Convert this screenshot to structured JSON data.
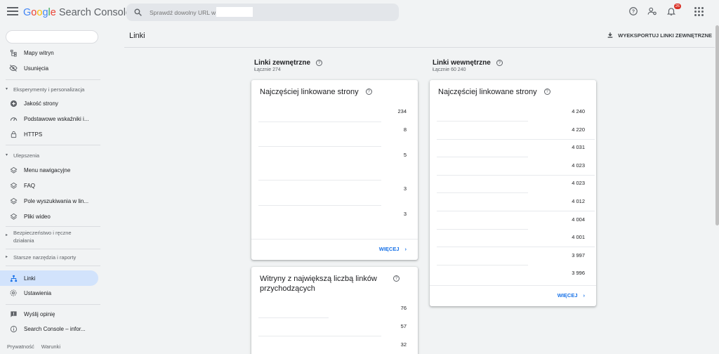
{
  "header": {
    "logo_google": [
      "G",
      "o",
      "o",
      "g",
      "l",
      "e"
    ],
    "logo_product": "Search Console",
    "search_placeholder": "Sprawdź dowolny URL w",
    "notification_count": "26"
  },
  "sidebar": {
    "items": [
      {
        "label": "Mapy witryn",
        "icon": "sitemap-icon"
      },
      {
        "label": "Usunięcia",
        "icon": "eye-off-icon"
      },
      {
        "label": "Jakość strony",
        "icon": "plus-circle-icon"
      },
      {
        "label": "Podstawowe wskaźniki i...",
        "icon": "gauge-icon"
      },
      {
        "label": "HTTPS",
        "icon": "lock-icon"
      },
      {
        "label": "Menu nawigacyjne",
        "icon": "layers-icon"
      },
      {
        "label": "FAQ",
        "icon": "layers-icon"
      },
      {
        "label": "Pole wyszukiwania w lin...",
        "icon": "layers-icon"
      },
      {
        "label": "Pliki wideo",
        "icon": "layers-icon"
      },
      {
        "label": "Linki",
        "icon": "links-icon"
      },
      {
        "label": "Ustawienia",
        "icon": "gear-icon"
      },
      {
        "label": "Wyślij opinię",
        "icon": "feedback-icon"
      },
      {
        "label": "Search Console – infor...",
        "icon": "info-icon"
      }
    ],
    "sections": {
      "experiments": "Eksperymenty i personalizacja",
      "enhancements": "Ulepszenia",
      "security": "Bezpieczeństwo i ręczne działania",
      "legacy": "Starsze narzędzia i raporty"
    },
    "footer": {
      "privacy": "Prywatność",
      "terms": "Warunki"
    }
  },
  "main": {
    "title": "Linki",
    "export_label": "WYEKSPORTUJ LINKI ZEWNĘTRZNE",
    "external": {
      "title": "Linki zewnętrzne",
      "total": "Łącznie 274",
      "top_pages": {
        "title": "Najczęściej linkowane strony",
        "values": [
          "234",
          "8",
          "5",
          "3",
          "3"
        ],
        "more": "WIĘCEJ"
      },
      "top_sites": {
        "title": "Witryny z największą liczbą linków przychodzących",
        "values": [
          "76",
          "57",
          "32"
        ]
      }
    },
    "internal": {
      "title": "Linki wewnętrzne",
      "total": "Łącznie 60 240",
      "top_pages": {
        "title": "Najczęściej linkowane strony",
        "values": [
          "4 240",
          "4 220",
          "4 031",
          "4 023",
          "4 023",
          "4 012",
          "4 004",
          "4 001",
          "3 997",
          "3 996"
        ],
        "more": "WIĘCEJ"
      }
    }
  }
}
